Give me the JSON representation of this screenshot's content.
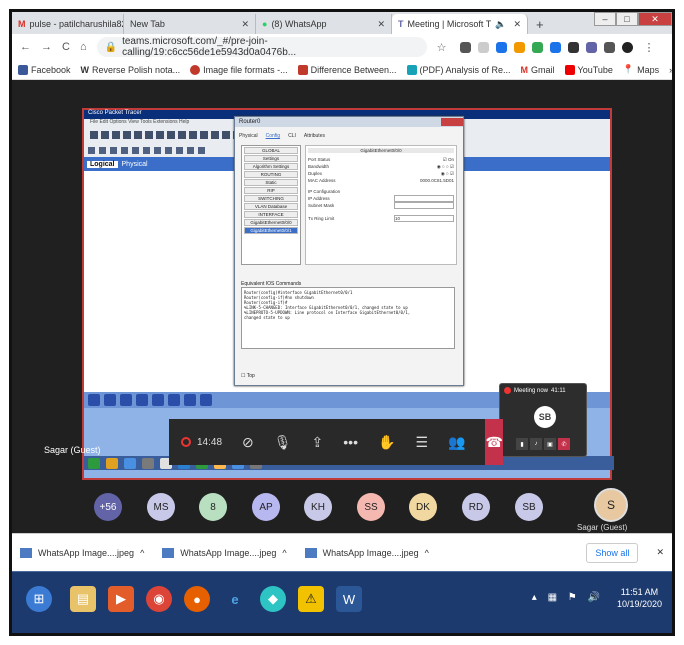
{
  "browser": {
    "tabs": [
      {
        "label": "pulse - patilcharushila82@",
        "icon": "gmail-icon"
      },
      {
        "label": "New Tab",
        "icon": ""
      },
      {
        "label": "(8) WhatsApp",
        "icon": "whatsapp-icon"
      },
      {
        "label": "Meeting | Microsoft T",
        "icon": "teams-icon"
      }
    ],
    "url": "teams.microsoft.com/_#/pre-join-calling/19:c6cc56de1e5943d0a0476b...",
    "bookmarks": [
      {
        "label": "Facebook",
        "color": "#3b5998"
      },
      {
        "label": "Reverse Polish nota...",
        "color": "#555"
      },
      {
        "label": "Image file formats -...",
        "color": "#c0392b"
      },
      {
        "label": "Difference Between...",
        "color": "#c0392b"
      },
      {
        "label": "(PDF) Analysis of Re...",
        "color": "#17a2b8"
      },
      {
        "label": "Gmail",
        "color": "#d93025"
      },
      {
        "label": "YouTube",
        "color": "#e00"
      },
      {
        "label": "Maps",
        "color": "#34a853"
      }
    ]
  },
  "packet_tracer": {
    "title": "Cisco Packet Tracer",
    "logical_tab": "Logical",
    "physical_tab": "Physical",
    "router_dialog": {
      "title": "Router0",
      "tabs": [
        "Physical",
        "Config",
        "CLI",
        "Attributes"
      ],
      "left_items": [
        "GLOBAL",
        "Settings",
        "Algorithm Settings",
        "ROUTING",
        "Static",
        "RIP",
        "SWITCHING",
        "VLAN Database",
        "INTERFACE",
        "GigabitEthernet0/0/0",
        "GigabitEthernet0/0/1"
      ],
      "panel_title": "GigabitEthernet0/0/0",
      "fields": [
        "Port Status",
        "Bandwidth",
        "Duplex",
        "MAC Address",
        "IP Configuration",
        "IP Address",
        "Subnet Mask",
        "Tx Ring Limit"
      ],
      "mac_value": "0000.0C81.5D01",
      "tx_value": "10",
      "cmd_label": "Equivalent IOS Commands",
      "cmd_lines": [
        "Router(config)#interface GigabitEthernet0/0/1",
        "Router(config-if)#no shutdown",
        "Router(config-if)#",
        "%LINK-5-CHANGED: Interface GigabitEthernet0/0/1, changed state to up",
        "",
        "%LINEPROTO-5-UPDOWN: Line protocol on Interface GigabitEthernet0/0/1,",
        "changed state to up"
      ],
      "top_label": "Top"
    }
  },
  "meeting_mini": {
    "title": "Meeting now",
    "time": "41:11",
    "initials": "SB"
  },
  "call_bar": {
    "timer": "14:48"
  },
  "presenter": "Sagar (Guest)",
  "participants": [
    {
      "initials": "+56",
      "color": "#6264a7"
    },
    {
      "initials": "MS",
      "color": "#c8c8e8"
    },
    {
      "initials": "8",
      "color": "#b8e0c0"
    },
    {
      "initials": "AP",
      "color": "#b8b8f0"
    },
    {
      "initials": "KH",
      "color": "#c8c8e8"
    },
    {
      "initials": "SS",
      "color": "#f4b8b0"
    },
    {
      "initials": "DK",
      "color": "#f0d8a0"
    },
    {
      "initials": "RD",
      "color": "#c8c8e8"
    },
    {
      "initials": "SB",
      "color": "#c8c8e8"
    },
    {
      "initials": "S",
      "color": "#e8c8a0"
    }
  ],
  "participant_label": "Sagar (Guest)",
  "downloads": {
    "items": [
      "WhatsApp Image....jpeg",
      "WhatsApp Image....jpeg",
      "WhatsApp Image....jpeg"
    ],
    "show_all": "Show all"
  },
  "taskbar": {
    "time": "11:51 AM",
    "date": "10/19/2020"
  }
}
